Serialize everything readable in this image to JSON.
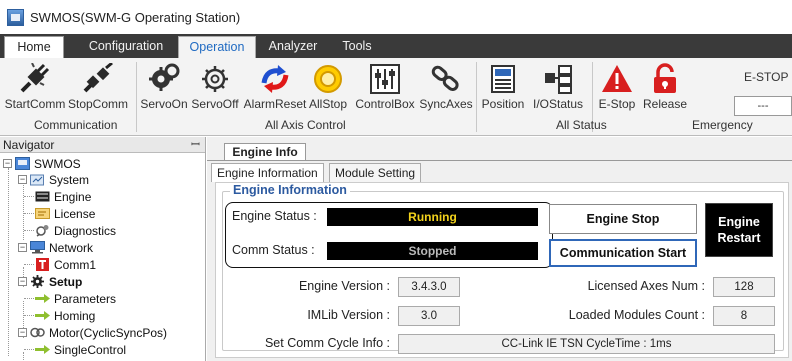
{
  "window": {
    "title": "SWMOS(SWM-G Operating Station)"
  },
  "menu": {
    "tabs": [
      "Home",
      "Configuration",
      "Operation",
      "Analyzer",
      "Tools"
    ],
    "active": "Operation"
  },
  "ribbon": {
    "buttons": [
      "StartComm",
      "StopComm",
      "ServoOn",
      "ServoOff",
      "AlarmReset",
      "AllStop",
      "ControlBox",
      "SyncAxes",
      "Position",
      "I/OStatus",
      "E-Stop",
      "Release"
    ],
    "groups": [
      "Communication",
      "All Axis Control",
      "All Status",
      "Emergency"
    ],
    "estop_label": "E-STOP :",
    "estop_value": "---"
  },
  "navigator": {
    "title": "Navigator",
    "pin": "ꟷ",
    "tree": [
      "SWMOS",
      "System",
      "Engine",
      "License",
      "Diagnostics",
      "Network",
      "Comm1",
      "Setup",
      "Parameters",
      "Homing",
      "Motor(CyclicSyncPos)",
      "SingleControl"
    ]
  },
  "content": {
    "doc_tab": "Engine Info",
    "sub_tabs": [
      "Engine Information",
      "Module Setting"
    ],
    "section_title": "Engine Information",
    "engine_status_label": "Engine Status :",
    "engine_status_value": "Running",
    "comm_status_label": "Comm Status :",
    "comm_status_value": "Stopped",
    "engine_stop_button": "Engine Stop",
    "comm_start_button": "Communication Start",
    "engine_restart_line1": "Engine",
    "engine_restart_line2": "Restart",
    "engine_version_label": "Engine Version :",
    "engine_version_value": "3.4.3.0",
    "licensed_axes_label": "Licensed Axes Num :",
    "licensed_axes_value": "128",
    "imlib_version_label": "IMLib Version :",
    "imlib_version_value": "3.0",
    "loaded_modules_label": "Loaded Modules Count :",
    "loaded_modules_value": "8",
    "comm_cycle_label": "Set Comm Cycle Info :",
    "comm_cycle_value": "CC-Link IE TSN CycleTime : 1ms"
  },
  "colors": {
    "running": "#f2d21c",
    "stopped": "#b9b9b9",
    "menu_active": "#1f6ac2",
    "section_title": "#2c5aa0"
  }
}
